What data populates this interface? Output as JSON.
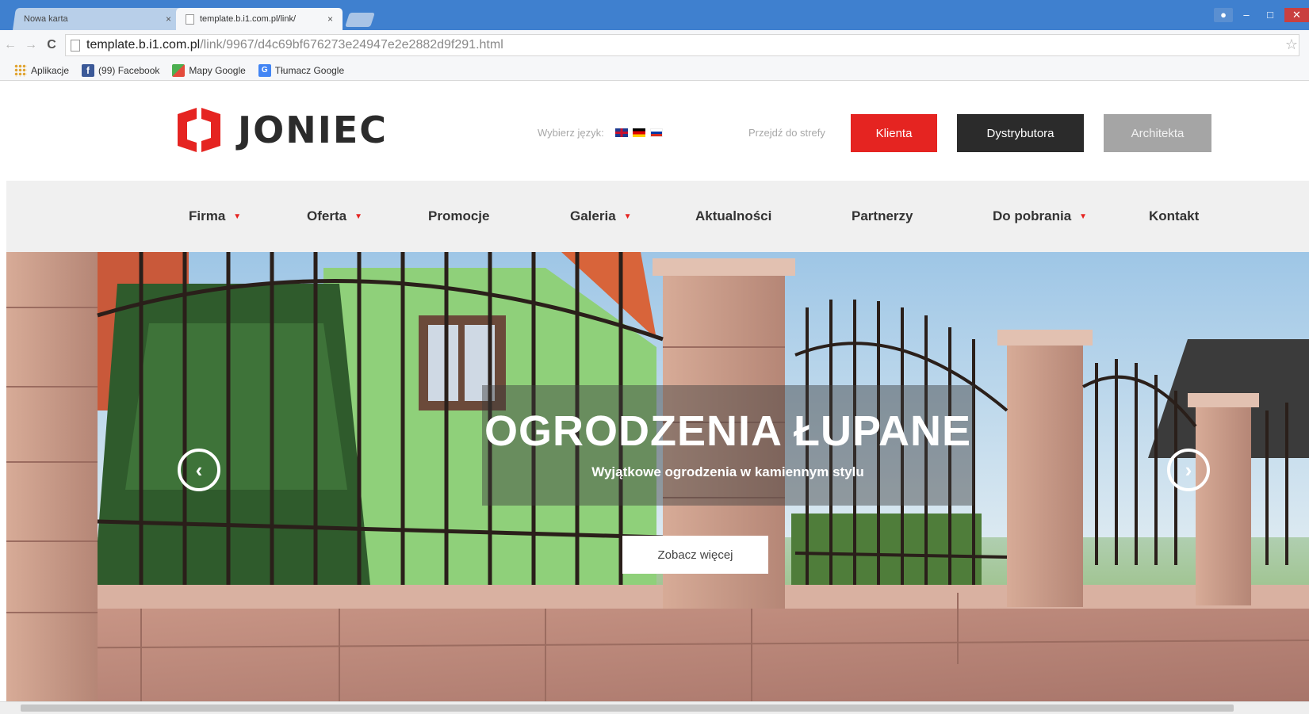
{
  "browser": {
    "tabs": [
      {
        "label": "Nowa karta",
        "active": false
      },
      {
        "label": "template.b.i1.com.pl/link/",
        "active": true
      }
    ],
    "close_glyph": "×",
    "url": {
      "host": "template.b.i1.com.pl",
      "path": "/link/9967/d4c69bf676273e24947e2e2882d9f291.html"
    },
    "bookmarks": [
      {
        "label": "Aplikacje",
        "icon": "apps-icon"
      },
      {
        "label": "(99) Facebook",
        "icon": "facebook-icon"
      },
      {
        "label": "Mapy Google",
        "icon": "maps-icon"
      },
      {
        "label": "Tłumacz Google",
        "icon": "translate-icon"
      }
    ]
  },
  "header": {
    "logo_text": "JONIEC",
    "language_label": "Wybierz język:",
    "languages": [
      "en",
      "de",
      "ru"
    ],
    "zone_label": "Przejdź do strefy",
    "zones": [
      {
        "label": "Klienta",
        "color": "#e52421"
      },
      {
        "label": "Dystrybutora",
        "color": "#2b2b2b"
      },
      {
        "label": "Architekta",
        "color": "#a5a5a5"
      }
    ]
  },
  "nav": {
    "items": [
      {
        "label": "Firma",
        "has_dropdown": true
      },
      {
        "label": "Oferta",
        "has_dropdown": true
      },
      {
        "label": "Promocje",
        "has_dropdown": false
      },
      {
        "label": "Galeria",
        "has_dropdown": true
      },
      {
        "label": "Aktualności",
        "has_dropdown": false
      },
      {
        "label": "Partnerzy",
        "has_dropdown": false
      },
      {
        "label": "Do pobrania",
        "has_dropdown": true
      },
      {
        "label": "Kontakt",
        "has_dropdown": false
      }
    ]
  },
  "hero": {
    "title": "OGRODZENIA ŁUPANE",
    "subtitle": "Wyjątkowe ogrodzenia w kamiennym stylu",
    "cta": "Zobacz więcej"
  },
  "colors": {
    "brand_red": "#e52421",
    "dark": "#2b2b2b",
    "gray": "#a5a5a5",
    "browser_blue": "#3f80cf"
  }
}
